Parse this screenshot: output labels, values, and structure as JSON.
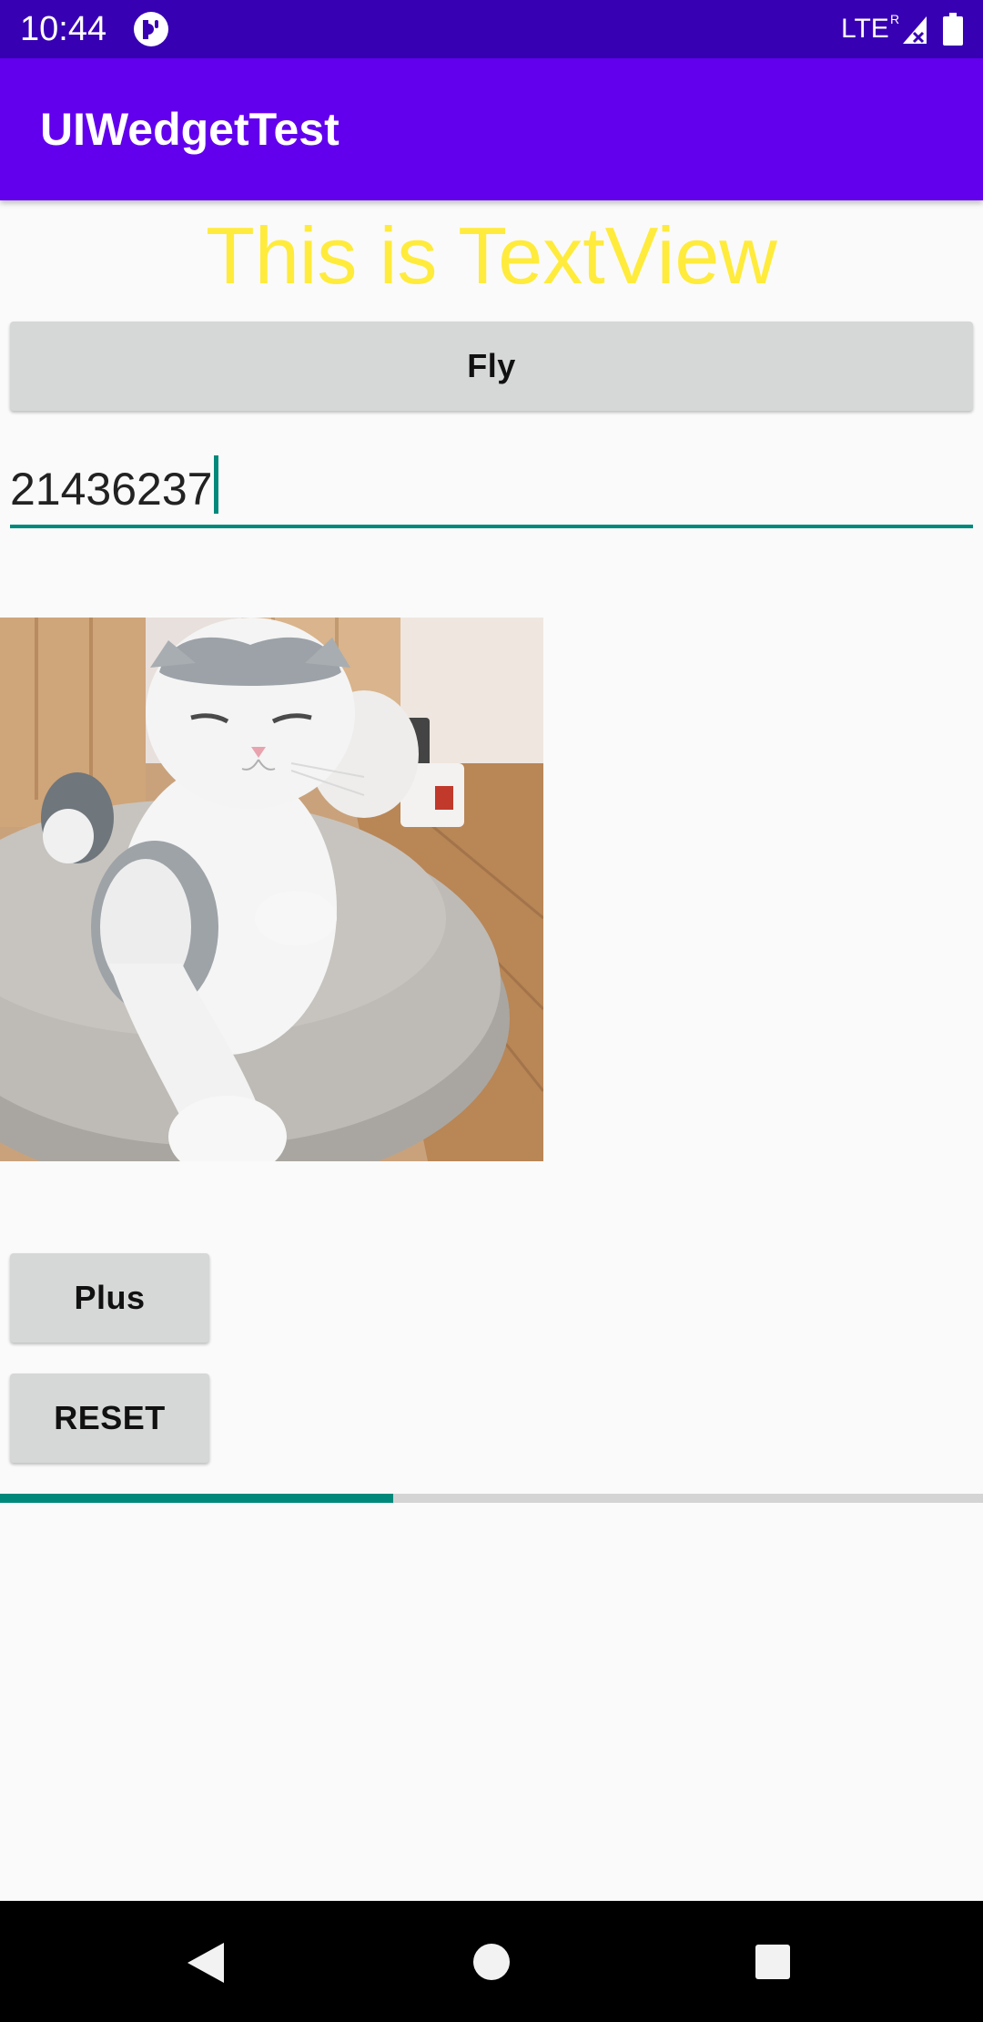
{
  "status_bar": {
    "time": "10:44",
    "network": "LTE",
    "roaming_mark": "R",
    "icons": [
      "app-notification-icon",
      "signal-icon",
      "battery-icon"
    ]
  },
  "app_bar": {
    "title": "UIWedgetTest",
    "color": "#6200EE"
  },
  "main": {
    "text_view": "This is TextView",
    "text_view_color": "#FFEB3B",
    "fly_button": "Fly",
    "edit_text_value": "21436237",
    "image_description": "cat-photo",
    "plus_button": "Plus",
    "reset_button": "RESET",
    "progress_fraction": 0.4,
    "accent_color": "#00897B"
  },
  "nav_bar": {
    "icons": [
      "back-icon",
      "home-icon",
      "recents-icon"
    ]
  }
}
